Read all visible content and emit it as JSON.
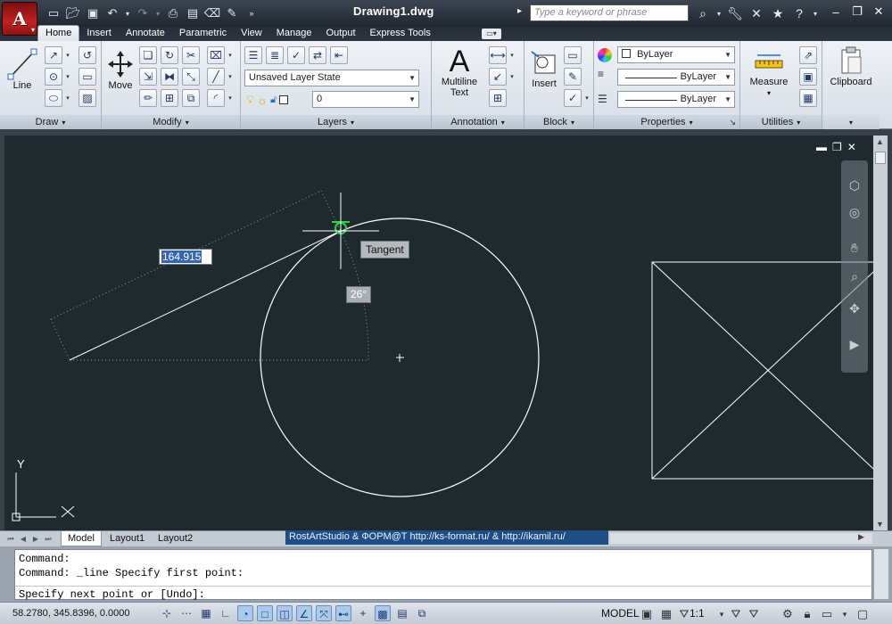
{
  "window": {
    "title": "Drawing1.dwg",
    "search_placeholder": "Type a keyword or phrase"
  },
  "ribbon": {
    "tabs": [
      "Home",
      "Insert",
      "Annotate",
      "Parametric",
      "View",
      "Manage",
      "Output",
      "Express Tools"
    ],
    "active_tab": "Home",
    "panels": {
      "draw": {
        "title": "Draw",
        "line_label": "Line"
      },
      "modify": {
        "title": "Modify",
        "move_label": "Move"
      },
      "layers": {
        "title": "Layers",
        "layer_state": "Unsaved Layer State",
        "current_layer": "0"
      },
      "annotation": {
        "title": "Annotation",
        "mtext_label_1": "Multiline",
        "mtext_label_2": "Text"
      },
      "block": {
        "title": "Block",
        "insert_label": "Insert"
      },
      "properties": {
        "title": "Properties",
        "color": "ByLayer",
        "linetype": "ByLayer",
        "lineweight": "ByLayer"
      },
      "utilities": {
        "title": "Utilities",
        "measure_label": "Measure"
      },
      "clipboard": {
        "clipboard_label": "Clipboard"
      }
    }
  },
  "canvas": {
    "dynamic_input_value": "164.915",
    "osnap_tooltip": "Tangent",
    "angle_tooltip": "26°",
    "ucs_y_label": "Y",
    "ucs_x_label": "X",
    "colors": {
      "background": "#1e2a2e",
      "geometry": "#ffffff",
      "tracking": "#79a87f",
      "snap_marker": "#2fd34a"
    }
  },
  "layout_tabs": [
    "Model",
    "Layout1",
    "Layout2"
  ],
  "active_layout": "Model",
  "credit_text": "RostArtStudio & ФОРМ@Т http://ks-format.ru/ & http://ikamil.ru/",
  "command_line": {
    "history": [
      "Command:",
      "Command: _line Specify first point:"
    ],
    "prompt": "Specify next point or [Undo]:"
  },
  "status_bar": {
    "coordinates": "58.2780,  345.8396, 0.0000",
    "model_label": "MODEL",
    "annotation_scale": "1:1"
  }
}
